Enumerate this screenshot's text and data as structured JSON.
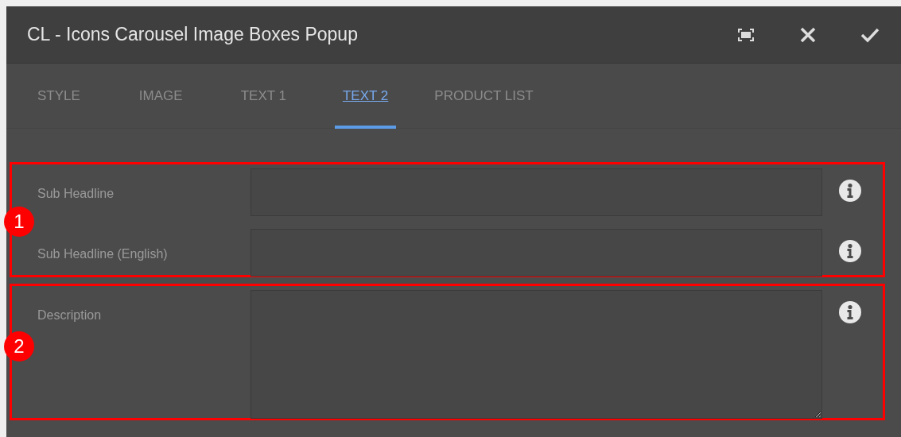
{
  "dialog": {
    "title": "CL - Icons Carousel Image Boxes Popup"
  },
  "tabs": [
    {
      "label": "STYLE",
      "selected": false
    },
    {
      "label": "IMAGE",
      "selected": false
    },
    {
      "label": "TEXT 1",
      "selected": false
    },
    {
      "label": "TEXT 2",
      "selected": true
    },
    {
      "label": "PRODUCT LIST",
      "selected": false
    }
  ],
  "annotations": [
    {
      "number": "1",
      "fields": [
        {
          "label": "Sub Headline",
          "kind": "text"
        },
        {
          "label": "Sub Headline (English)",
          "kind": "text"
        }
      ]
    },
    {
      "number": "2",
      "fields": [
        {
          "label": "Description",
          "kind": "textarea"
        }
      ]
    }
  ]
}
